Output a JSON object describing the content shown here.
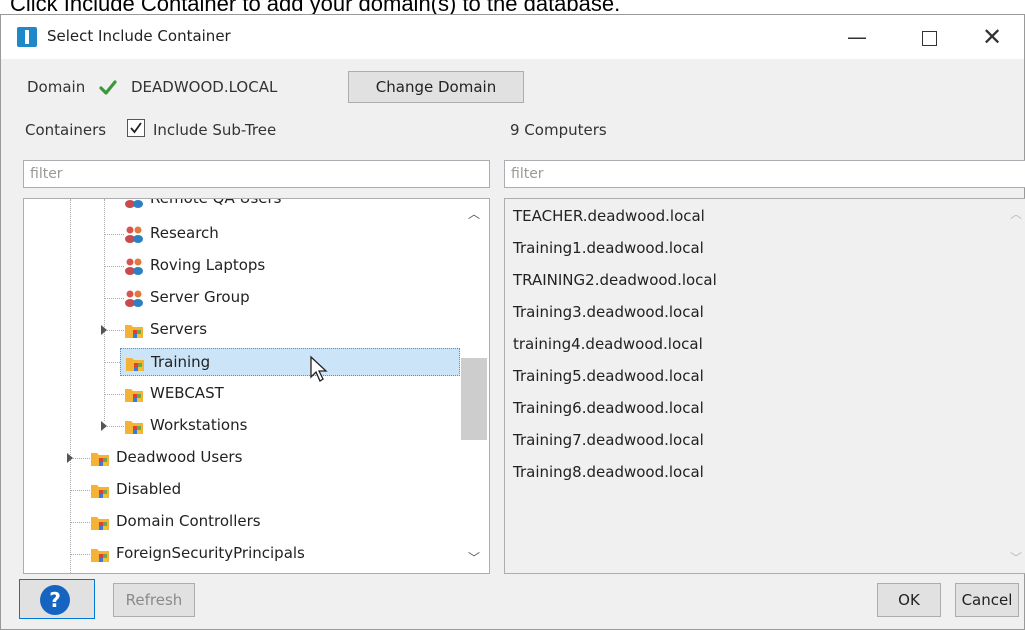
{
  "caption": "Click Include Container to add your domain(s) to the database.",
  "window": {
    "title": "Select Include Container",
    "minimize_glyph": "—",
    "close_glyph": "✕"
  },
  "domain": {
    "label": "Domain",
    "status_icon": "green-check-icon",
    "value": "DEADWOOD.LOCAL",
    "change_button": "Change Domain"
  },
  "containers": {
    "label": "Containers",
    "include_subtree_label": "Include Sub-Tree",
    "include_subtree_checked": true,
    "filter_placeholder": "filter",
    "tree": [
      {
        "label": "Remote QA Users",
        "icon": "group-icon",
        "depth": 2
      },
      {
        "label": "Research",
        "icon": "group-icon",
        "depth": 2
      },
      {
        "label": "Roving Laptops",
        "icon": "group-icon",
        "depth": 2
      },
      {
        "label": "Server Group",
        "icon": "group-icon",
        "depth": 2
      },
      {
        "label": "Servers",
        "icon": "ou-folder-icon",
        "depth": 2,
        "expandable": true
      },
      {
        "label": "Training",
        "icon": "ou-folder-icon",
        "depth": 2,
        "selected": true
      },
      {
        "label": "WEBCAST",
        "icon": "ou-folder-icon",
        "depth": 2
      },
      {
        "label": "Workstations",
        "icon": "ou-folder-icon",
        "depth": 2,
        "expandable": true
      },
      {
        "label": "Deadwood Users",
        "icon": "ou-folder-icon",
        "depth": 1,
        "expandable": true
      },
      {
        "label": "Disabled",
        "icon": "ou-folder-icon",
        "depth": 1
      },
      {
        "label": "Domain Controllers",
        "icon": "ou-folder-icon",
        "depth": 1
      },
      {
        "label": "ForeignSecurityPrincipals",
        "icon": "ou-folder-icon",
        "depth": 1
      }
    ]
  },
  "computers": {
    "count_label": "9 Computers",
    "filter_placeholder": "filter",
    "items": [
      "TEACHER.deadwood.local",
      "Training1.deadwood.local",
      "TRAINING2.deadwood.local",
      "Training3.deadwood.local",
      "training4.deadwood.local",
      "Training5.deadwood.local",
      "Training6.deadwood.local",
      "Training7.deadwood.local",
      "Training8.deadwood.local"
    ]
  },
  "footer": {
    "help_glyph": "?",
    "refresh": "Refresh",
    "ok": "OK",
    "cancel": "Cancel"
  },
  "colors": {
    "selection": "#cce4f7",
    "check_green": "#3a9a3a",
    "help_blue": "#1565c0"
  }
}
